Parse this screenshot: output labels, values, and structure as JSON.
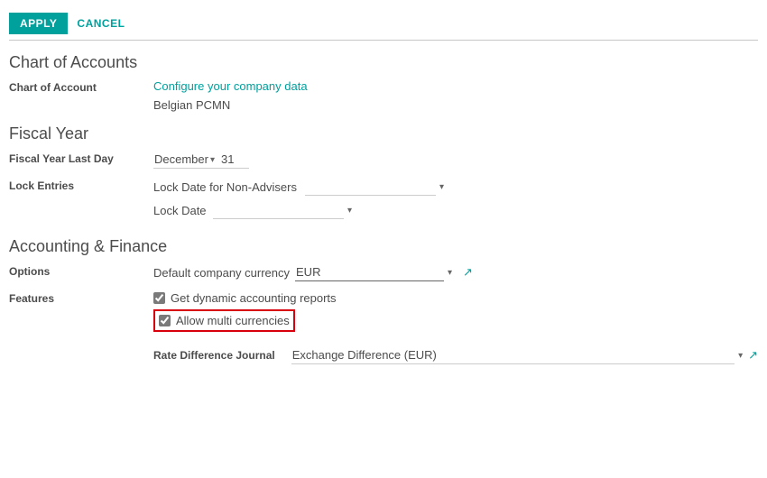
{
  "topbar": {
    "apply_label": "APPLY",
    "cancel_label": "CANCEL"
  },
  "sections": {
    "chart": {
      "title": "Chart of Accounts",
      "row_label": "Chart of Account",
      "configure_link": "Configure your company data",
      "value": "Belgian PCMN"
    },
    "fiscal": {
      "title": "Fiscal Year",
      "last_day_label": "Fiscal Year Last Day",
      "month_value": "December",
      "day_value": "31",
      "lock_entries_label": "Lock Entries",
      "lock_non_advisers_label": "Lock Date for Non-Advisers",
      "lock_non_advisers_value": "",
      "lock_date_label": "Lock Date",
      "lock_date_value": ""
    },
    "acct": {
      "title": "Accounting & Finance",
      "options_label": "Options",
      "default_currency_label": "Default company currency",
      "default_currency_value": "EUR",
      "features_label": "Features",
      "feature_dynamic_reports": "Get dynamic accounting reports",
      "feature_multi_currencies": "Allow multi currencies",
      "rate_diff_label": "Rate Difference Journal",
      "rate_diff_value": "Exchange Difference (EUR)"
    }
  },
  "icons": {
    "caret": "▾",
    "external": "↗"
  }
}
